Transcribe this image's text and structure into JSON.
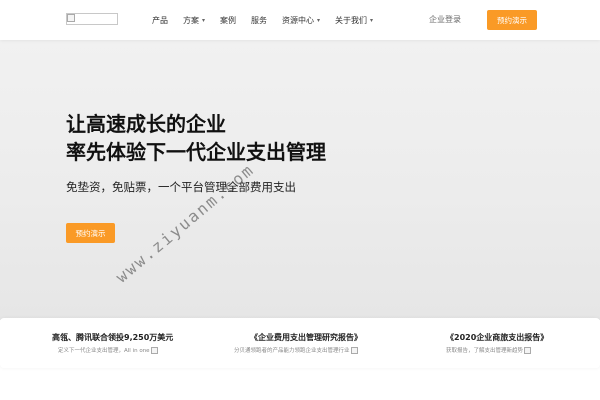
{
  "header": {
    "nav": [
      {
        "label": "产品",
        "dropdown": false
      },
      {
        "label": "方案",
        "dropdown": true
      },
      {
        "label": "案例",
        "dropdown": false
      },
      {
        "label": "服务",
        "dropdown": false
      },
      {
        "label": "资源中心",
        "dropdown": true
      },
      {
        "label": "关于我们",
        "dropdown": true
      }
    ],
    "login_label": "企业登录",
    "demo_label": "预约演示",
    "caret": "▾",
    "accent_color": "#fa9a26"
  },
  "hero": {
    "title_line1": "让高速成长的企业",
    "title_line2": "率先体验下一代企业支出管理",
    "subtitle": "免垫资，免贴票，一个平台管理全部费用支出",
    "button_label": "预约演示",
    "watermark": "www.ziyuanm.com"
  },
  "news": [
    {
      "title": "高瓴、腾讯联合领投9,250万美元",
      "desc": "定义下一代企业支出管理，All in one"
    },
    {
      "title": "《企业费用支出管理研究报告》",
      "desc": "分贝通领跑者的产品能力领跑企业支出管理行业"
    },
    {
      "title": "《2020企业商旅支出报告》",
      "desc": "获取报告，了解支出管理新趋势"
    }
  ]
}
